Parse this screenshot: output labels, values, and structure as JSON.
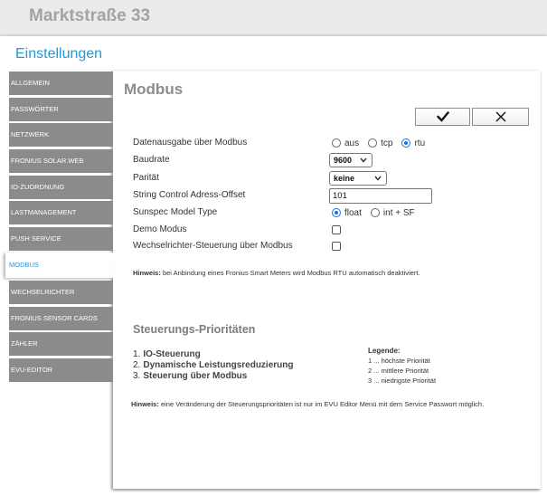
{
  "header": {
    "title": "Marktstraße 33"
  },
  "settings": {
    "title": "Einstellungen"
  },
  "sidebar": {
    "items": [
      {
        "label": "ALLGEMEIN",
        "active": false
      },
      {
        "label": "PASSWÖRTER",
        "active": false
      },
      {
        "label": "NETZWERK",
        "active": false
      },
      {
        "label": "FRONIUS SOLAR.WEB",
        "active": false
      },
      {
        "label": "IO-ZUORDNUNG",
        "active": false
      },
      {
        "label": "LASTMANAGEMENT",
        "active": false
      },
      {
        "label": "PUSH SERVICE",
        "active": false
      },
      {
        "label": "MODBUS",
        "active": true
      },
      {
        "label": "WECHSELRICHTER",
        "active": false
      },
      {
        "label": "FRONIUS SENSOR CARDS",
        "active": false
      },
      {
        "label": "ZÄHLER",
        "active": false
      },
      {
        "label": "EVU-EDITOR",
        "active": false
      }
    ]
  },
  "main": {
    "title": "Modbus",
    "actions": {
      "save_icon": "check-icon",
      "cancel_icon": "close-icon"
    },
    "form": {
      "select_icon": "chevron-down-icon",
      "data_output": {
        "label": "Datenausgabe über Modbus",
        "options": [
          {
            "label": "aus",
            "checked": false
          },
          {
            "label": "tcp",
            "checked": false
          },
          {
            "label": "rtu",
            "checked": true
          }
        ]
      },
      "baudrate": {
        "label": "Baudrate",
        "value": "9600"
      },
      "parity": {
        "label": "Parität",
        "value": "keine"
      },
      "string_control_offset": {
        "label": "String Control Adress-Offset",
        "value": "101"
      },
      "sunspec_model_type": {
        "label": "Sunspec Model Type",
        "options": [
          {
            "label": "float",
            "checked": true
          },
          {
            "label": "int + SF",
            "checked": false
          }
        ]
      },
      "demo_mode": {
        "label": "Demo Modus",
        "checked": false
      },
      "inverter_control": {
        "label": "Wechselrichter-Steuerung über Modbus",
        "checked": false
      }
    },
    "hint_smart_meter": {
      "prefix": "Hinweis:",
      "text": "bei Anbindung eines Fronius Smart Meters wird Modbus RTU automatisch deaktiviert."
    },
    "priorities": {
      "title": "Steuerungs-Prioritäten",
      "items": [
        {
          "number": "1.",
          "label": "IO-Steuerung"
        },
        {
          "number": "2.",
          "label": "Dynamische Leistungsreduzierung"
        },
        {
          "number": "3.",
          "label": "Steuerung über Modbus"
        }
      ],
      "legend": {
        "title": "Legende:",
        "entries": [
          "1 ... höchste Priorität",
          "2 ... mittlere Priorität",
          "3 ... niedrigste Priorität"
        ]
      }
    },
    "hint_priorities": {
      "prefix": "Hinweis:",
      "text": "eine Veränderung der Steuerungsprioritäten ist nur im EVU Editor Menü mit dem Service Passwort möglich."
    }
  },
  "colors": {
    "accent": "#1e9ad6",
    "menu_background": "#8b8b8b",
    "menu_text": "#ffffff",
    "heading": "#8c8c8c",
    "radio_checked": "#1a73e8"
  }
}
